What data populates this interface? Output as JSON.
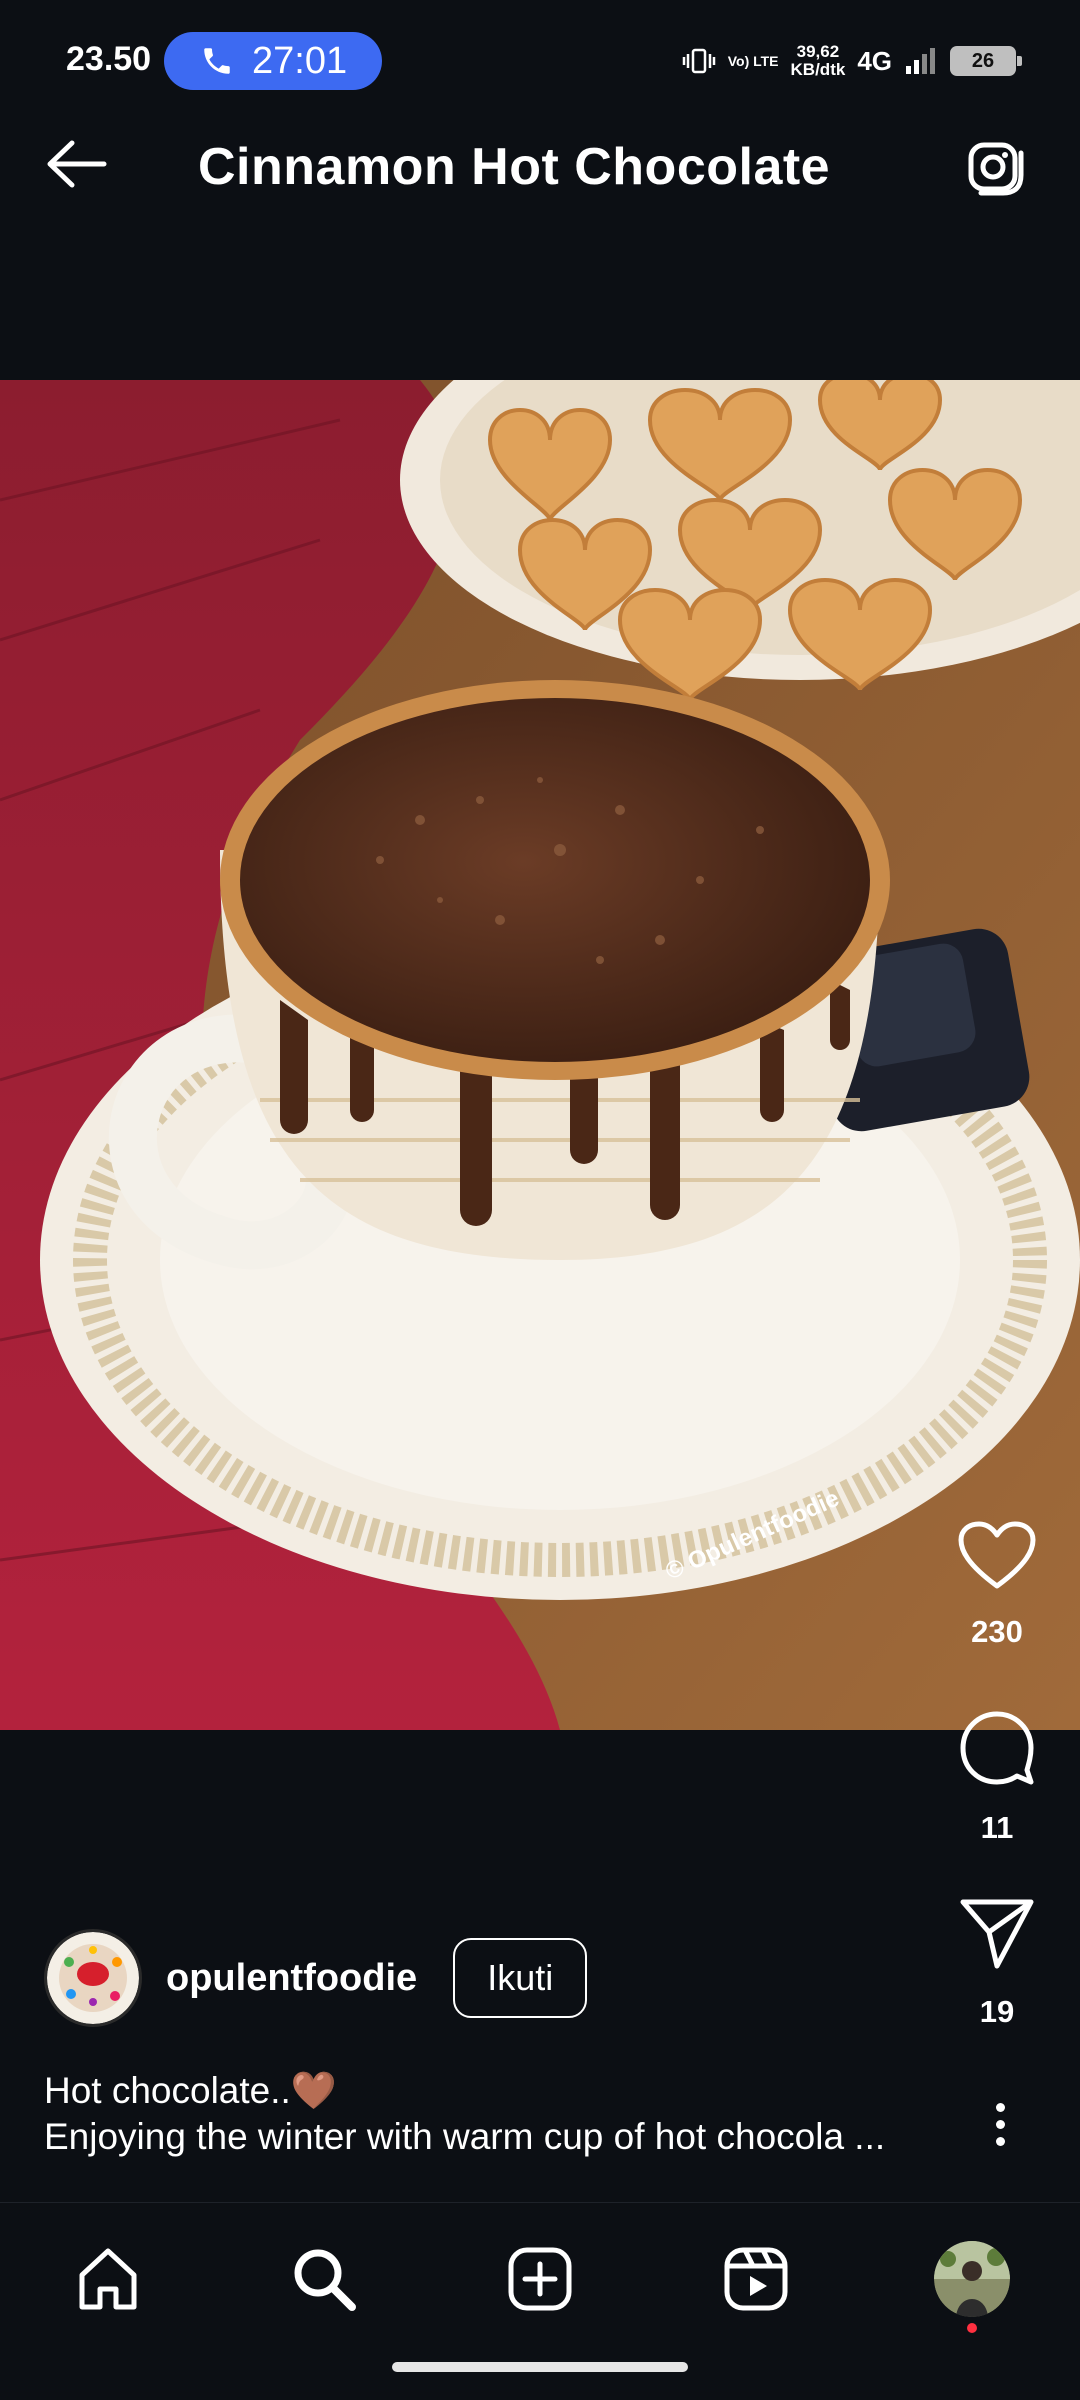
{
  "status_bar": {
    "time": "23.50",
    "call_timer": "27:01",
    "volte_label": "Vo) LTE",
    "net_speed_value": "39,62",
    "net_speed_unit": "KB/dtk",
    "net_type": "4G",
    "battery": "26"
  },
  "header": {
    "title": "Cinnamon Hot Chocolate"
  },
  "photo": {
    "watermark": "© Opulentfoodie"
  },
  "actions": {
    "likes": "230",
    "comments": "11",
    "shares": "19"
  },
  "author": {
    "username": "opulentfoodie",
    "follow_label": "Ikuti"
  },
  "caption": {
    "line1": "Hot chocolate..🤎",
    "line2": "Enjoying the winter with warm cup of hot chocola ..."
  },
  "icons": {
    "back": "arrow-left-icon",
    "camera": "camera-icon",
    "like": "heart-icon",
    "comment": "comment-bubble-icon",
    "share": "paper-plane-icon",
    "more": "more-vertical-icon",
    "home": "home-icon",
    "search": "search-icon",
    "create": "plus-square-icon",
    "reels": "reels-icon"
  },
  "colors": {
    "background": "#0c0f14",
    "call_pill": "#3d6af2",
    "notification_dot": "#ff3040"
  }
}
